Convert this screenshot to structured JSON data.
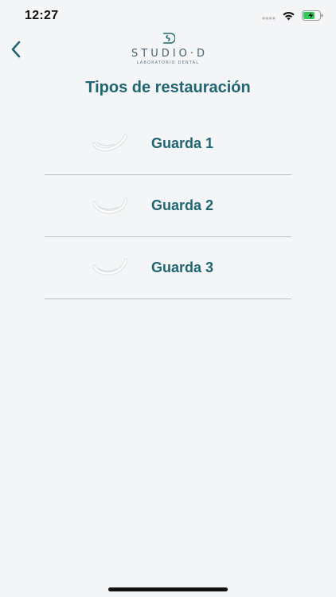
{
  "status": {
    "time": "12:27"
  },
  "header": {
    "brand_name": "STUDIO·D",
    "brand_subtitle": "LABORATORIO DENTAL"
  },
  "page": {
    "title": "Tipos de restauración"
  },
  "items": [
    {
      "label": "Guarda 1"
    },
    {
      "label": "Guarda 2"
    },
    {
      "label": "Guarda 3"
    }
  ],
  "colors": {
    "accent": "#1f6672",
    "background": "#f4f5f7",
    "divider": "#b9bdc0"
  }
}
